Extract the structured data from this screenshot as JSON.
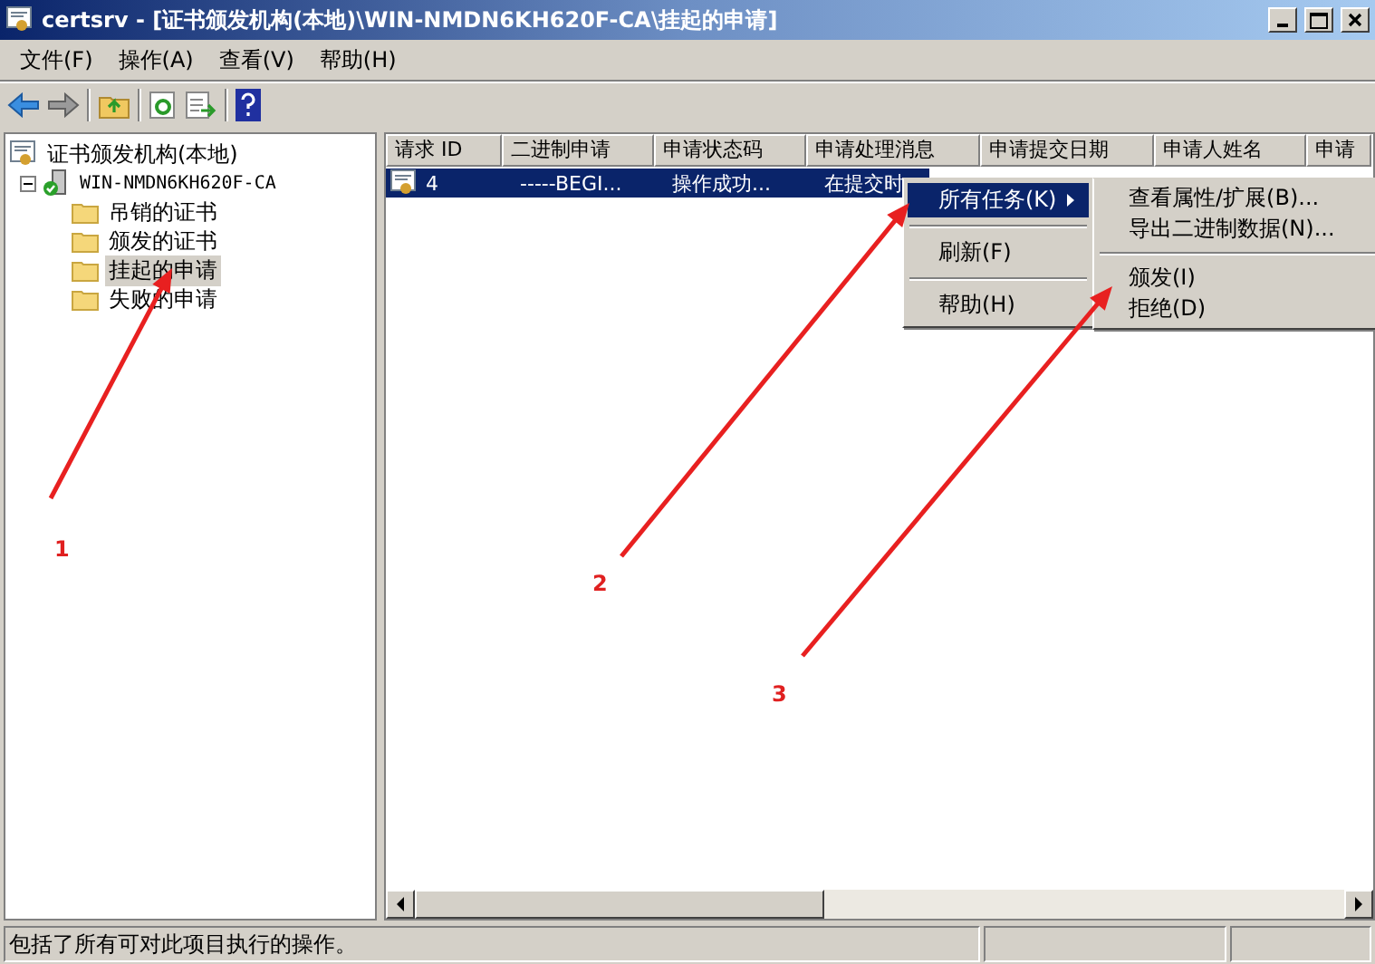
{
  "window": {
    "title": "certsrv - [证书颁发机构(本地)\\WIN-NMDN6KH620F-CA\\挂起的申请]"
  },
  "menu_bar": [
    "文件(F)",
    "操作(A)",
    "查看(V)",
    "帮助(H)"
  ],
  "tree": {
    "label": "证书颁发机构(本地)",
    "kind": "root",
    "selected": false,
    "children": [
      {
        "label": "WIN-NMDN6KH620F-CA",
        "kind": "server",
        "expanded": true,
        "selected": false,
        "children": [
          {
            "label": "吊销的证书",
            "kind": "folder",
            "selected": false
          },
          {
            "label": "颁发的证书",
            "kind": "folder",
            "selected": false
          },
          {
            "label": "挂起的申请",
            "kind": "folder",
            "selected": true
          },
          {
            "label": "失败的申请",
            "kind": "folder",
            "selected": false
          }
        ]
      }
    ]
  },
  "table": {
    "columns": [
      "请求 ID",
      "二进制申请",
      "申请状态码",
      "申请处理消息",
      "申请提交日期",
      "申请人姓名",
      "申请"
    ],
    "rows": [
      {
        "selected": true,
        "cells": [
          "4",
          "-----BEGI...",
          "操作成功...",
          "在提交时"
        ]
      }
    ]
  },
  "context_menu": {
    "items": [
      {
        "label": "所有任务(K)",
        "selected": true,
        "submenu": true
      },
      {
        "label": "刷新(F)",
        "selected": false,
        "submenu": false
      },
      {
        "label": "帮助(H)",
        "selected": false,
        "submenu": false
      }
    ]
  },
  "submenu": {
    "groups": [
      [
        "查看属性/扩展(B)...",
        "导出二进制数据(N)..."
      ],
      [
        "颁发(I)",
        "拒绝(D)"
      ]
    ]
  },
  "annotations": [
    "1",
    "2",
    "3"
  ],
  "status_bar": "包括了所有可对此项目执行的操作。"
}
